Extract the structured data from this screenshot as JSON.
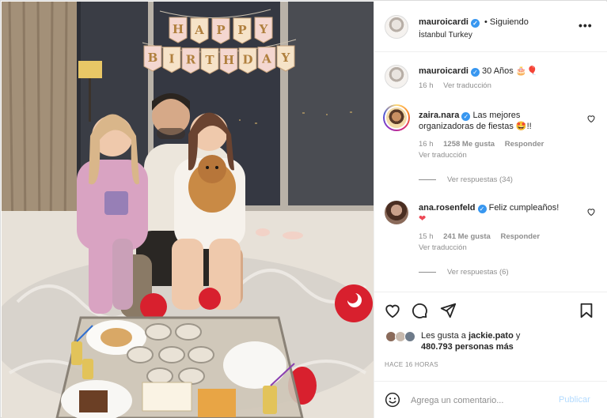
{
  "photo": {
    "banner_letters": [
      "H",
      "A",
      "P",
      "P",
      "Y",
      "B",
      "I",
      "R",
      "T",
      "H",
      "D",
      "A",
      "Y"
    ]
  },
  "post_header": {
    "username": "mauroicardi",
    "following_label": "Siguiendo",
    "location": "İstanbul Turkey"
  },
  "caption": {
    "username": "mauroicardi",
    "text": "30 Años",
    "time": "16 h",
    "translate": "Ver traducción"
  },
  "comments": [
    {
      "username": "zaira.nara",
      "text_line1": "Las mejores",
      "text_line2": "organizadoras de fiestas 🤩!!",
      "time": "16 h",
      "likes": "1258 Me gusta",
      "reply": "Responder",
      "translate": "Ver traducción",
      "view_replies": "Ver respuestas (34)"
    },
    {
      "username": "ana.rosenfeld",
      "text_line1": "Feliz cumpleaños!",
      "text_line2": "❤",
      "time": "15 h",
      "likes": "241 Me gusta",
      "reply": "Responder",
      "translate": "Ver traducción",
      "view_replies": "Ver respuestas (6)"
    }
  ],
  "likes": {
    "prefix": "Les gusta a",
    "user": "jackie.pato",
    "connector": "y",
    "count": "480.793 personas más"
  },
  "timestamp": "HACE 16 HORAS",
  "composer": {
    "placeholder": "Agrega un comentario...",
    "publish_label": "Publicar"
  },
  "icons": {
    "verified": "verified-badge-icon",
    "more": "more-options-icon",
    "like": "heart-icon",
    "comment": "comment-bubble-icon",
    "share": "paper-plane-icon",
    "save": "bookmark-icon",
    "emoji": "emoji-smiley-icon"
  },
  "colors": {
    "verified_blue": "#3897f0",
    "publish_disabled": "#b3dbff",
    "muted_text": "#8e8e8e",
    "heart_red": "#ed4956"
  }
}
